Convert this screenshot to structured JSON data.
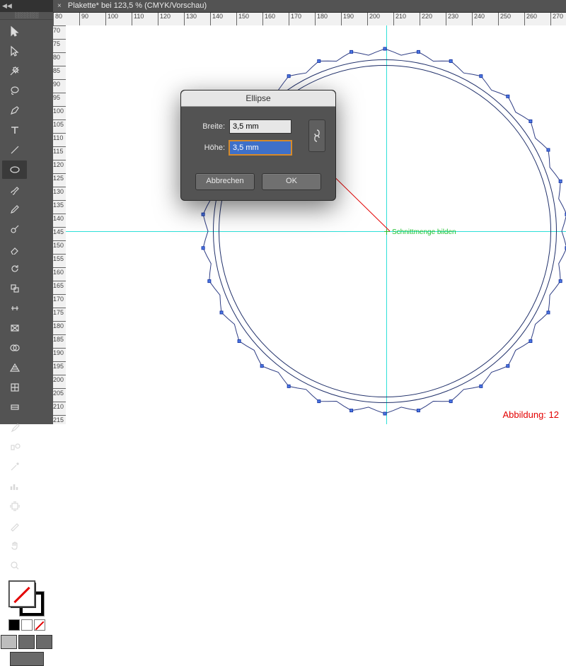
{
  "document": {
    "tab_title": "Plakette* bei 123,5 % (CMYK/Vorschau)"
  },
  "dialog": {
    "title": "Ellipse",
    "width_label": "Breite:",
    "height_label": "Höhe:",
    "width_value": "3,5 mm",
    "height_value": "3,5 mm",
    "cancel_label": "Abbrechen",
    "ok_label": "OK"
  },
  "canvas": {
    "smart_guide_label": "Schnittmenge bilden",
    "figure_label": "Abbildung: 12"
  },
  "ruler": {
    "top": [
      "80",
      "90",
      "100",
      "110",
      "120",
      "130",
      "140",
      "150",
      "160",
      "170",
      "180",
      "190",
      "200",
      "210",
      "220",
      "230",
      "240",
      "250",
      "260",
      "270"
    ],
    "left": [
      "70",
      "75",
      "80",
      "85",
      "90",
      "95",
      "100",
      "105",
      "110",
      "115",
      "120",
      "125",
      "130",
      "135",
      "140",
      "145",
      "150",
      "155",
      "160",
      "165",
      "170",
      "175",
      "180",
      "185",
      "190",
      "195",
      "200",
      "205",
      "210",
      "215"
    ]
  },
  "tools": [
    "selection-tool",
    "direct-selection-tool",
    "magic-wand-tool",
    "lasso-tool",
    "pen-tool",
    "type-tool",
    "line-tool",
    "ellipse-tool",
    "paintbrush-tool",
    "pencil-tool",
    "blob-brush-tool",
    "eraser-tool",
    "rotate-tool",
    "scale-tool",
    "width-tool",
    "free-transform-tool",
    "shape-builder-tool",
    "perspective-grid-tool",
    "mesh-tool",
    "gradient-tool",
    "eyedropper-tool",
    "blend-tool",
    "symbol-sprayer-tool",
    "column-graph-tool",
    "artboard-tool",
    "slice-tool",
    "hand-tool",
    "zoom-tool"
  ]
}
